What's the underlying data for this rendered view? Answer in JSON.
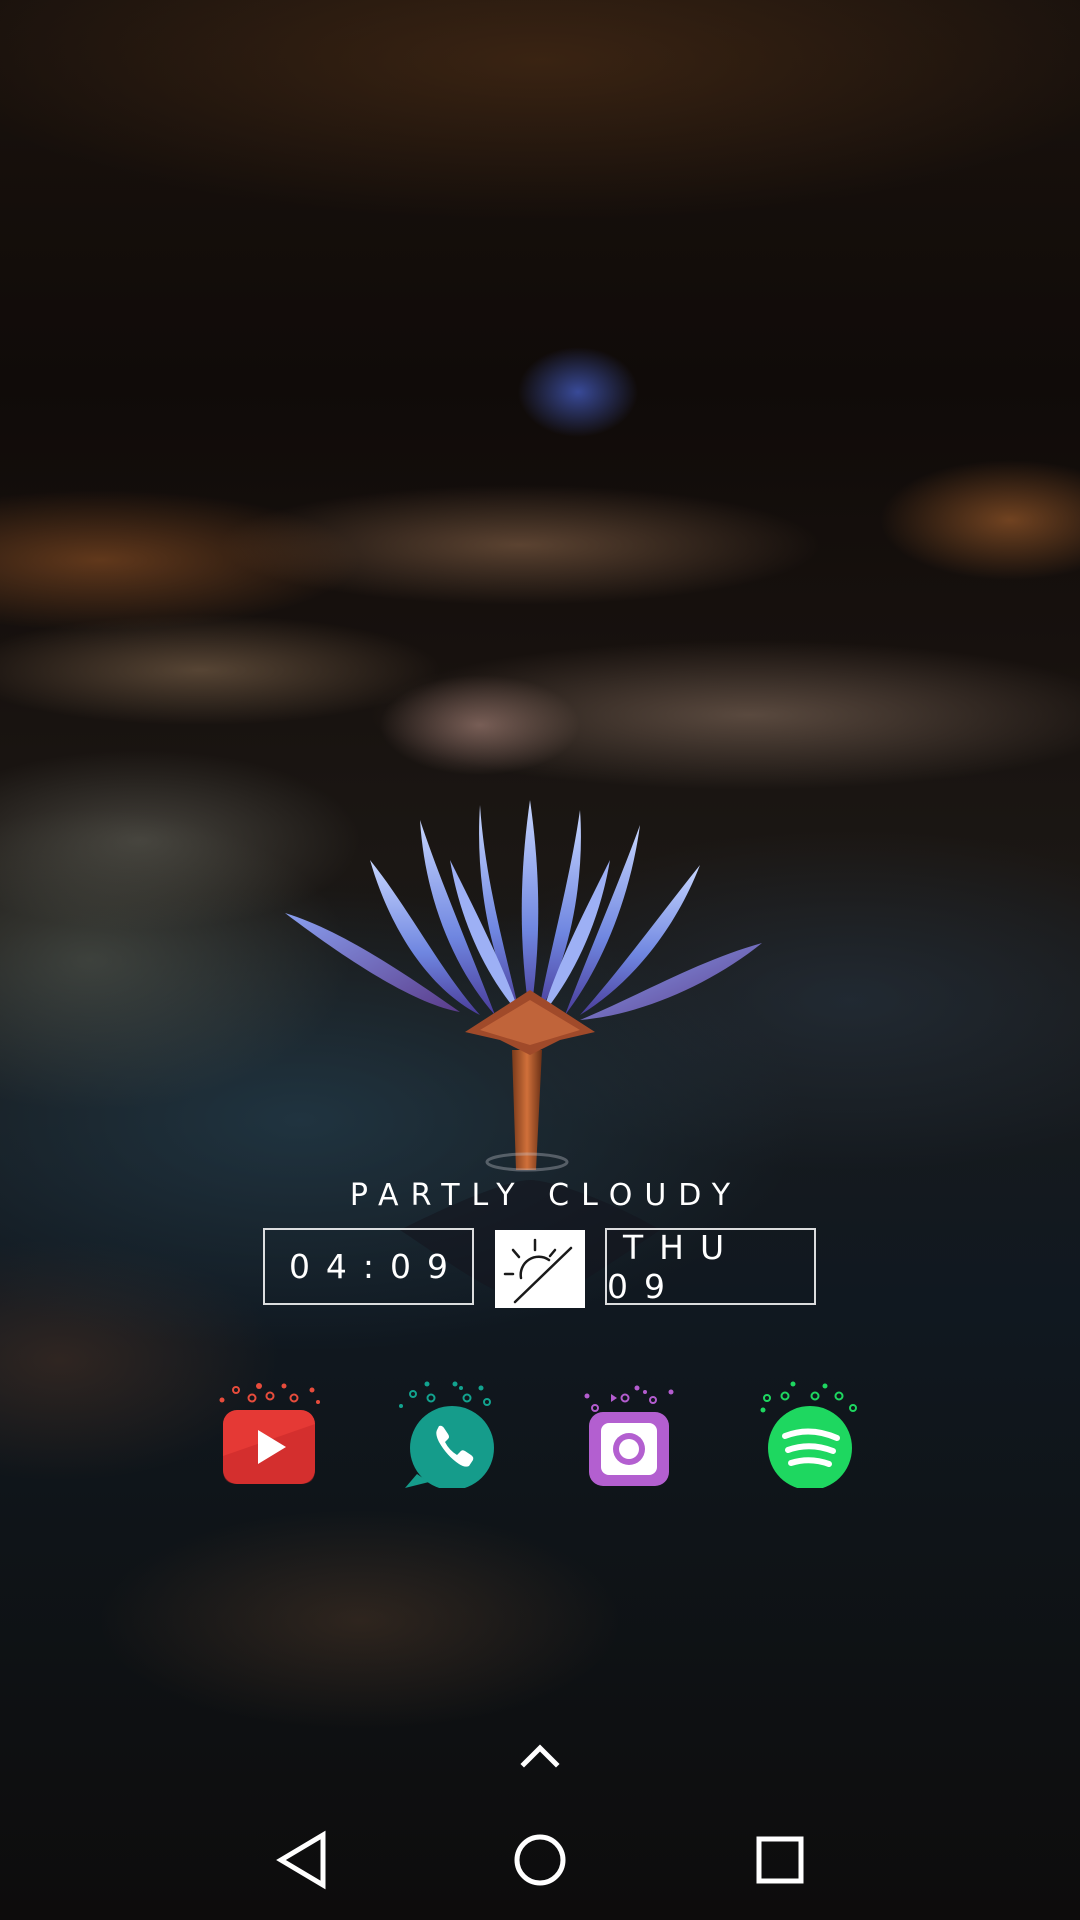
{
  "widget": {
    "condition": "PARTLY CLOUDY",
    "time": "04:09",
    "date": "THU 09",
    "weather_icon": "partly-cloudy-sun-icon"
  },
  "dock": {
    "apps": [
      {
        "name": "YouTube",
        "icon": "youtube-icon",
        "color": "#e53935"
      },
      {
        "name": "Phone",
        "icon": "phone-icon",
        "color": "#129e8c"
      },
      {
        "name": "Instagram",
        "icon": "instagram-icon",
        "color": "#b058d0"
      },
      {
        "name": "Spotify",
        "icon": "spotify-icon",
        "color": "#1ed760"
      }
    ]
  },
  "navigation": {
    "drawer_icon": "chevron-up-icon",
    "back_icon": "back-triangle-icon",
    "home_icon": "home-circle-icon",
    "recents_icon": "recents-square-icon"
  }
}
